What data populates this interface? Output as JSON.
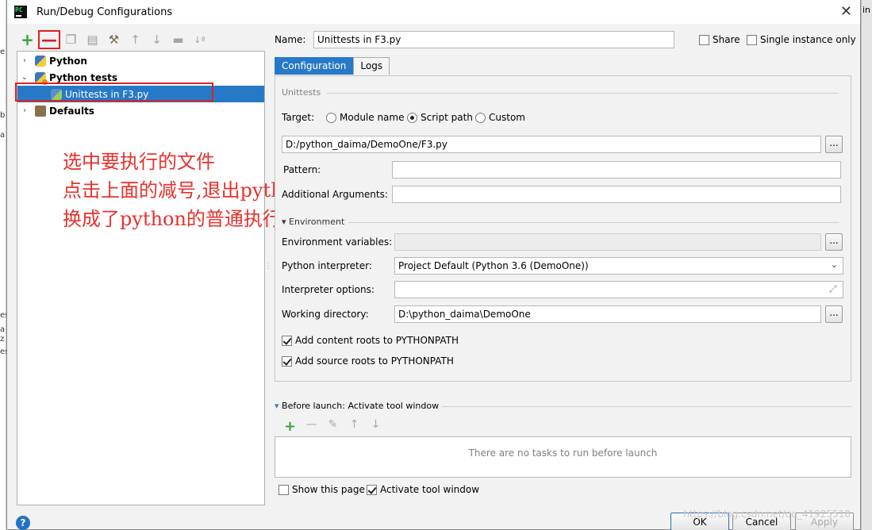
{
  "window": {
    "title": "Run/Debug Configurations",
    "close_glyph": "✕",
    "app_icon_text": "PC"
  },
  "background": {
    "right_edge_text": "in",
    "left_edge_chars": [
      "e",
      "b",
      "a",
      "es",
      "a",
      "z",
      "es"
    ]
  },
  "toolbar": {
    "plus": "+",
    "minus": "—",
    "copy": "❐",
    "save": "▤",
    "edit_defaults": "⚒",
    "move_up": "↑",
    "move_down": "↓",
    "folder": "▬",
    "sort": "↓ª"
  },
  "tree": {
    "items": [
      {
        "label": "Python",
        "arrow": "›"
      },
      {
        "label": "Python tests",
        "arrow": "⌄"
      },
      {
        "label": "Unittests in F3.py"
      },
      {
        "label": "Defaults",
        "arrow": "›"
      }
    ]
  },
  "annotation": {
    "lines": [
      "选中要执行的文件",
      "点击上面的减号,退出python tests执行模式,",
      "换成了python的普通执行模式"
    ]
  },
  "form": {
    "name_label": "Name:",
    "name_value": "Unittests in F3.py",
    "share_label": "Share",
    "single_instance_label": "Single instance only",
    "tabs": [
      "Configuration",
      "Logs"
    ],
    "section_unittests": "Unittests",
    "target_label": "Target:",
    "target_options": [
      "Module name",
      "Script path",
      "Custom"
    ],
    "target_selected": "Script path",
    "script_path": "D:/python_daima/DemoOne/F3.py",
    "browse": "...",
    "pattern_label": "Pattern:",
    "pattern_value": "",
    "additional_args_label": "Additional Arguments:",
    "additional_args_value": "",
    "section_environment": "Environment",
    "env_vars_label": "Environment variables:",
    "env_vars_value": "",
    "interpreter_label": "Python interpreter:",
    "interpreter_value": "Project Default (Python 3.6 (DemoOne))",
    "interp_options_label": "Interpreter options:",
    "interp_options_value": "",
    "working_dir_label": "Working directory:",
    "working_dir_value": "D:\\python_daima\\DemoOne",
    "add_content_roots": "Add content roots to PYTHONPATH",
    "add_source_roots": "Add source roots to PYTHONPATH",
    "expand_glyph": "⤢",
    "dropdown_glyph": "⌄"
  },
  "before_launch": {
    "title": "Before launch: Activate tool window",
    "empty_text": "There are no tasks to run before launch",
    "toolbar": {
      "plus": "+",
      "minus": "—",
      "edit": "✎",
      "up": "↑",
      "down": "↓"
    },
    "show_this_page": "Show this page",
    "activate_tool_window": "Activate tool window"
  },
  "buttons": {
    "ok": "OK",
    "cancel": "Cancel",
    "apply": "Apply",
    "help": "?"
  },
  "watermark": "https://blog.csdn.net/qq_41925518"
}
